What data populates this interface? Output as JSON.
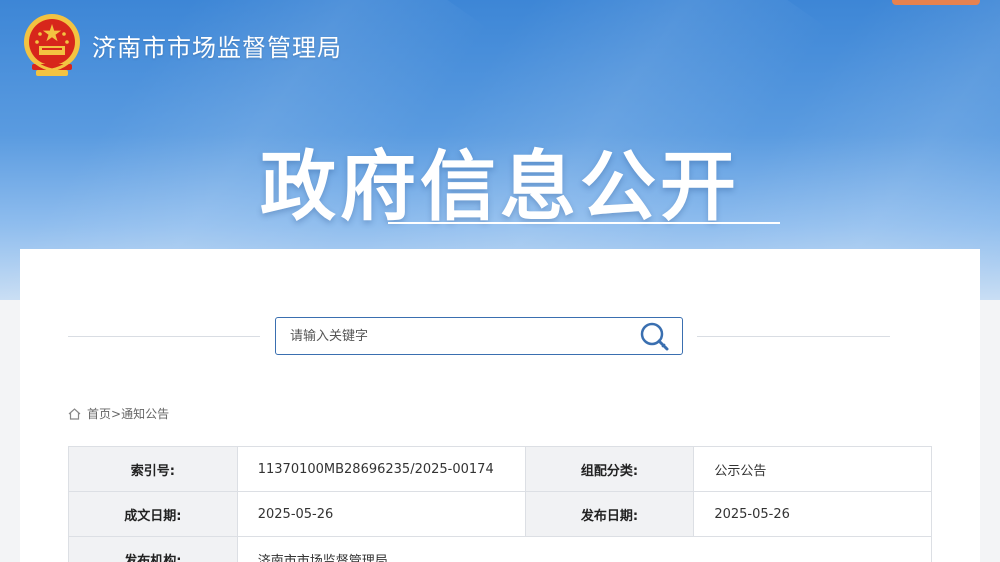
{
  "header": {
    "site_title": "济南市市场监督管理局",
    "page_title": "政府信息公开"
  },
  "search": {
    "placeholder": "请输入关键字"
  },
  "breadcrumb": {
    "home": "首页",
    "separator": ">",
    "current": "通知公告"
  },
  "info_table": {
    "rows": [
      {
        "label1": "索引号:",
        "value1": "11370100MB28696235/2025-00174",
        "label2": "组配分类:",
        "value2": "公示公告"
      },
      {
        "label1": "成文日期:",
        "value1": "2025-05-26",
        "label2": "发布日期:",
        "value2": "2025-05-26"
      },
      {
        "label1": "发布机构:",
        "value1": "济南市市场监督管理局"
      }
    ]
  },
  "colors": {
    "hero_top": "#3d86d6",
    "hero_bottom": "#c9def4",
    "search_border": "#3a6fb0",
    "emblem_red": "#d7261b",
    "emblem_gold": "#f3c341",
    "top_tab": "#e6824f"
  },
  "icons": {
    "emblem": "national-emblem-icon",
    "search": "magnifier-icon",
    "home": "home-icon"
  }
}
